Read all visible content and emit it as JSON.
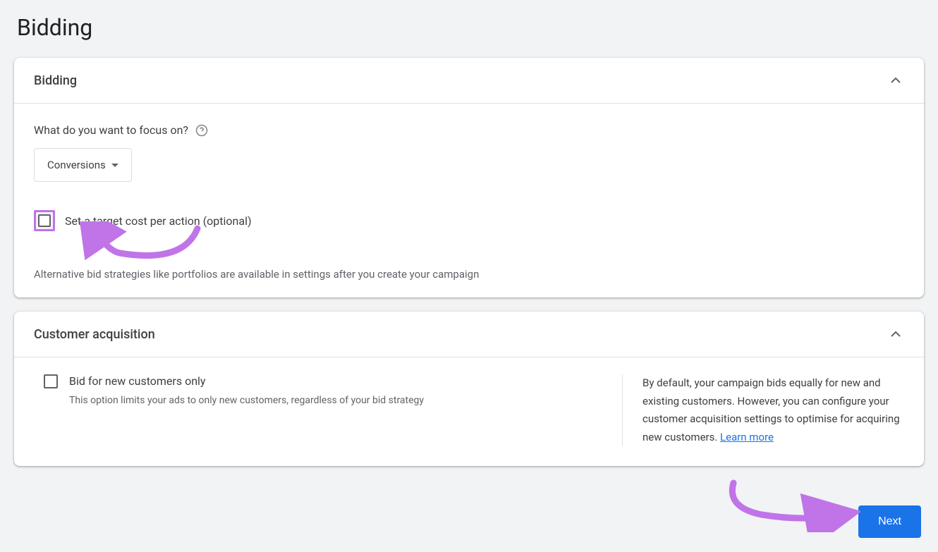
{
  "page": {
    "title": "Bidding"
  },
  "bidding_card": {
    "title": "Bidding",
    "focus_question": "What do you want to focus on?",
    "dropdown_value": "Conversions",
    "target_cpa_label": "Set a target cost per action (optional)",
    "alt_strategies_hint": "Alternative bid strategies like portfolios are available in settings after you create your campaign"
  },
  "customer_card": {
    "title": "Customer acquisition",
    "bid_new_label": "Bid for new customers only",
    "bid_new_hint": "This option limits your ads to only new customers, regardless of your bid strategy",
    "info_text": "By default, your campaign bids equally for new and existing customers. However, you can configure your customer acquisition settings to optimise for acquiring new customers. ",
    "learn_more": "Learn more"
  },
  "buttons": {
    "next": "Next"
  }
}
